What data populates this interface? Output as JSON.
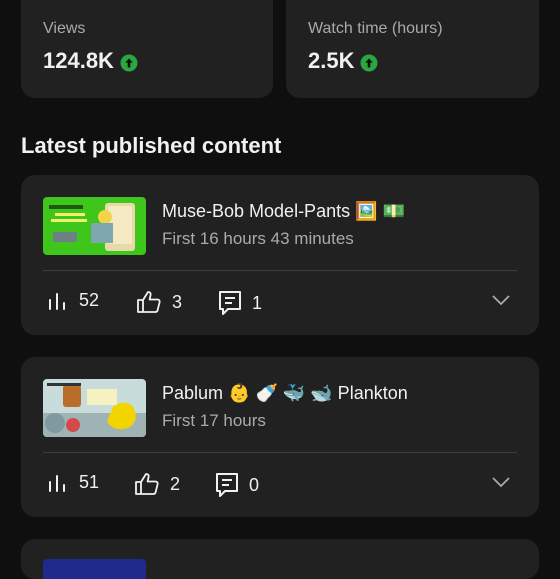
{
  "stats": [
    {
      "label": "Views",
      "value": "124.8K",
      "trend_icon": "arrow-up-circle-icon",
      "trend_color": "#2ba640"
    },
    {
      "label": "Watch time (hours)",
      "value": "2.5K",
      "trend_icon": "arrow-up-circle-icon",
      "trend_color": "#2ba640"
    }
  ],
  "section_title": "Latest published content",
  "videos": [
    {
      "title": "Muse-Bob Model-Pants 🖼️ 💵",
      "subtitle": "First 16 hours 43 minutes",
      "views": "52",
      "likes": "3",
      "comments": "1",
      "thumbnail_color": "#3ec61c"
    },
    {
      "title": "Pablum 👶 🍼 🐳 🐋 Plankton",
      "subtitle": "First 17 hours",
      "views": "51",
      "likes": "2",
      "comments": "0",
      "thumbnail_color": "#cfe3e3"
    }
  ],
  "icons": {
    "views": "bar-chart-icon",
    "likes": "thumbs-up-icon",
    "comments": "comment-icon",
    "expand": "chevron-down-icon"
  }
}
